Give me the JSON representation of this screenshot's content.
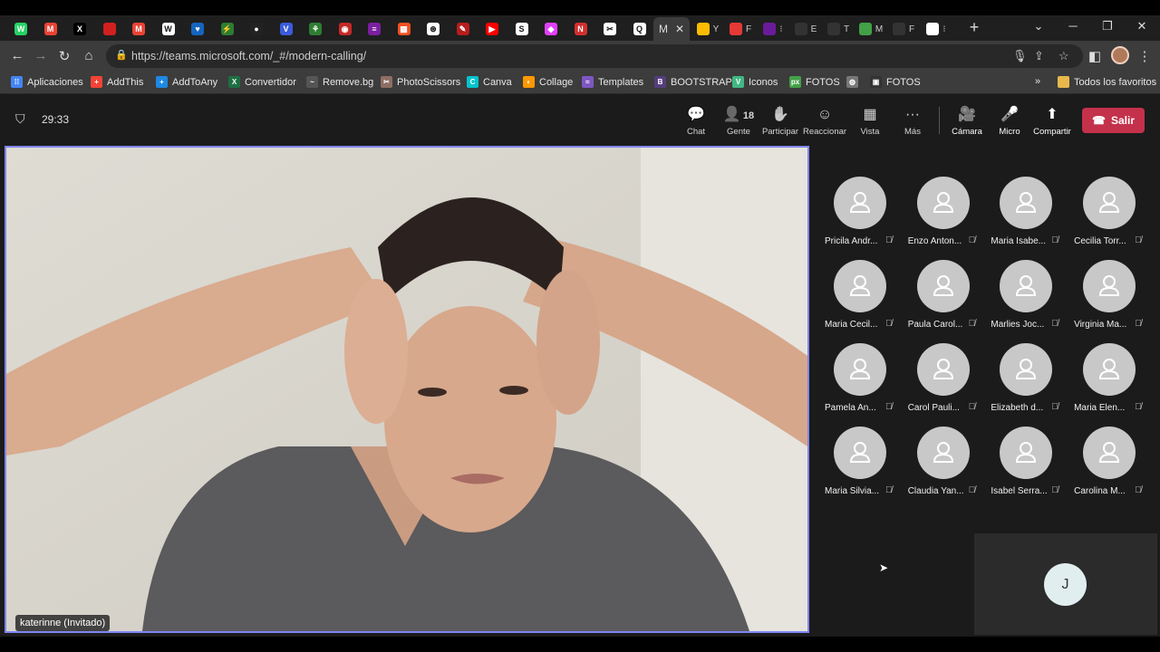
{
  "browser": {
    "tabs": [
      {
        "icon": "whatsapp-icon",
        "color": "#25d366",
        "glyph": "W"
      },
      {
        "icon": "gmail-icon",
        "color": "#ea4335",
        "glyph": "M"
      },
      {
        "icon": "x-icon",
        "color": "#000000",
        "glyph": "X"
      },
      {
        "icon": "red-square-icon",
        "color": "#d21f1f",
        "glyph": ""
      },
      {
        "icon": "gmail-icon",
        "color": "#ea4335",
        "glyph": "M"
      },
      {
        "icon": "wix-icon",
        "color": "#ffffff",
        "glyph": "W"
      },
      {
        "icon": "heart-icon",
        "color": "#1565c0",
        "glyph": "♥"
      },
      {
        "icon": "bolt-icon",
        "color": "#2e7d32",
        "glyph": "⚡"
      },
      {
        "icon": "record-icon",
        "color": "#222222",
        "glyph": "●"
      },
      {
        "icon": "v-icon",
        "color": "#3b5bdb",
        "glyph": "V"
      },
      {
        "icon": "link-icon",
        "color": "#2e7d32",
        "glyph": "⚘"
      },
      {
        "icon": "lips-icon",
        "color": "#c62828",
        "glyph": "◉"
      },
      {
        "icon": "purple-icon",
        "color": "#7b1fa2",
        "glyph": "≡"
      },
      {
        "icon": "windows-icon",
        "color": "#f25022",
        "glyph": "▦"
      },
      {
        "icon": "openai-icon",
        "color": "#ffffff",
        "glyph": "⊛"
      },
      {
        "icon": "script-icon",
        "color": "#b71c1c",
        "glyph": "✎"
      },
      {
        "icon": "youtube-icon",
        "color": "#ff0000",
        "glyph": "▶"
      },
      {
        "icon": "stf-icon",
        "color": "#ffffff",
        "glyph": "S"
      },
      {
        "icon": "copilot-icon",
        "color": "#e040fb",
        "glyph": "◆"
      },
      {
        "icon": "n-icon",
        "color": "#d32f2f",
        "glyph": "N"
      },
      {
        "icon": "capcut-icon",
        "color": "#ffffff",
        "glyph": "✂"
      },
      {
        "icon": "q-icon",
        "color": "#ffffff",
        "glyph": "Q"
      }
    ],
    "active_tab_label": "M",
    "right_tabs": [
      {
        "icon": "drive-icon",
        "color": "#fbbc04",
        "label": "Y"
      },
      {
        "icon": "chrome-icon",
        "color": "#e53935",
        "label": "F"
      },
      {
        "icon": "purple-icon",
        "color": "#6a1b9a",
        "label": "⁝"
      },
      {
        "icon": "text-icon",
        "color": "#333333",
        "label": "E"
      },
      {
        "icon": "wave-icon",
        "color": "#333333",
        "label": "T"
      },
      {
        "icon": "px-icon",
        "color": "#43a047",
        "label": "M"
      },
      {
        "icon": "is-icon",
        "color": "#333333",
        "label": "F"
      },
      {
        "icon": "circle-icon",
        "color": "#ffffff",
        "label": "⁝"
      }
    ],
    "url": "https://teams.microsoft.com/_#/modern-calling/",
    "bookmarks": [
      {
        "label": "Aplicaciones",
        "icon": "apps-grid-icon",
        "color": "#4285f4",
        "glyph": "⁞⁞"
      },
      {
        "label": "AddThis",
        "icon": "addthis-icon",
        "color": "#f44336",
        "glyph": "+"
      },
      {
        "label": "AddToAny",
        "icon": "addtoany-icon",
        "color": "#1e88e5",
        "glyph": "+"
      },
      {
        "label": "Convertidor",
        "icon": "excel-icon",
        "color": "#1d6f42",
        "glyph": "X"
      },
      {
        "label": "Remove.bg",
        "icon": "removebg-icon",
        "color": "#555555",
        "glyph": "~"
      },
      {
        "label": "PhotoScissors",
        "icon": "scissors-icon",
        "color": "#8d6e63",
        "glyph": "✂"
      },
      {
        "label": "Canva",
        "icon": "canva-icon",
        "color": "#00c4cc",
        "glyph": "C"
      },
      {
        "label": "Collage",
        "icon": "collage-icon",
        "color": "#ff9800",
        "glyph": "◐"
      },
      {
        "label": "Templates",
        "icon": "templates-icon",
        "color": "#7e57c2",
        "glyph": "≈"
      },
      {
        "label": "BOOTSTRAP",
        "icon": "bootstrap-icon",
        "color": "#563d7c",
        "glyph": "B"
      },
      {
        "label": "Iconos",
        "icon": "vue-icon",
        "color": "#41b883",
        "glyph": "V"
      },
      {
        "label": "FOTOS",
        "icon": "px-icon",
        "color": "#43a047",
        "glyph": "px"
      },
      {
        "label": "",
        "icon": "globe-icon",
        "color": "#777777",
        "glyph": "◍"
      },
      {
        "label": "FOTOS",
        "icon": "camera-icon",
        "color": "#333333",
        "glyph": "▣"
      }
    ],
    "all_bookmarks_label": "Todos los favoritos"
  },
  "teams": {
    "call_timer": "29:33",
    "toolbar": [
      {
        "label": "Chat",
        "icon": "chat-icon",
        "glyph": "💬",
        "badge": ""
      },
      {
        "label": "Gente",
        "icon": "people-icon",
        "glyph": "👤",
        "badge": "18"
      },
      {
        "label": "Participar",
        "icon": "raise-hand-icon",
        "glyph": "✋",
        "badge": ""
      },
      {
        "label": "Reaccionar",
        "icon": "smile-icon",
        "glyph": "☺",
        "badge": ""
      },
      {
        "label": "Vista",
        "icon": "view-grid-icon",
        "glyph": "▦",
        "badge": ""
      },
      {
        "label": "Más",
        "icon": "more-icon",
        "glyph": "···",
        "badge": ""
      }
    ],
    "controls": [
      {
        "label": "Cámara",
        "icon": "camera-off-icon",
        "glyph": "🎥"
      },
      {
        "label": "Micro",
        "icon": "mic-off-icon",
        "glyph": "🎤"
      },
      {
        "label": "Compartir",
        "icon": "share-screen-icon",
        "glyph": "⬆"
      }
    ],
    "leave_label": "Salir",
    "leave_color": "#c4314b",
    "spotlight_name": "katerinne (Invitado)",
    "participants": [
      "Pricila Andr...",
      "Enzo Anton...",
      "Maria Isabe...",
      "Cecilia Torr...",
      "Maria Cecil...",
      "Paula Carol...",
      "Marlies Joc...",
      "Virginia Ma...",
      "Pamela An...",
      "Carol Pauli...",
      "Elizabeth d...",
      "Maria Elen...",
      "Maria Silvia...",
      "Claudia Yan...",
      "Isabel Serra...",
      "Carolina M..."
    ],
    "self_initial": "J"
  }
}
